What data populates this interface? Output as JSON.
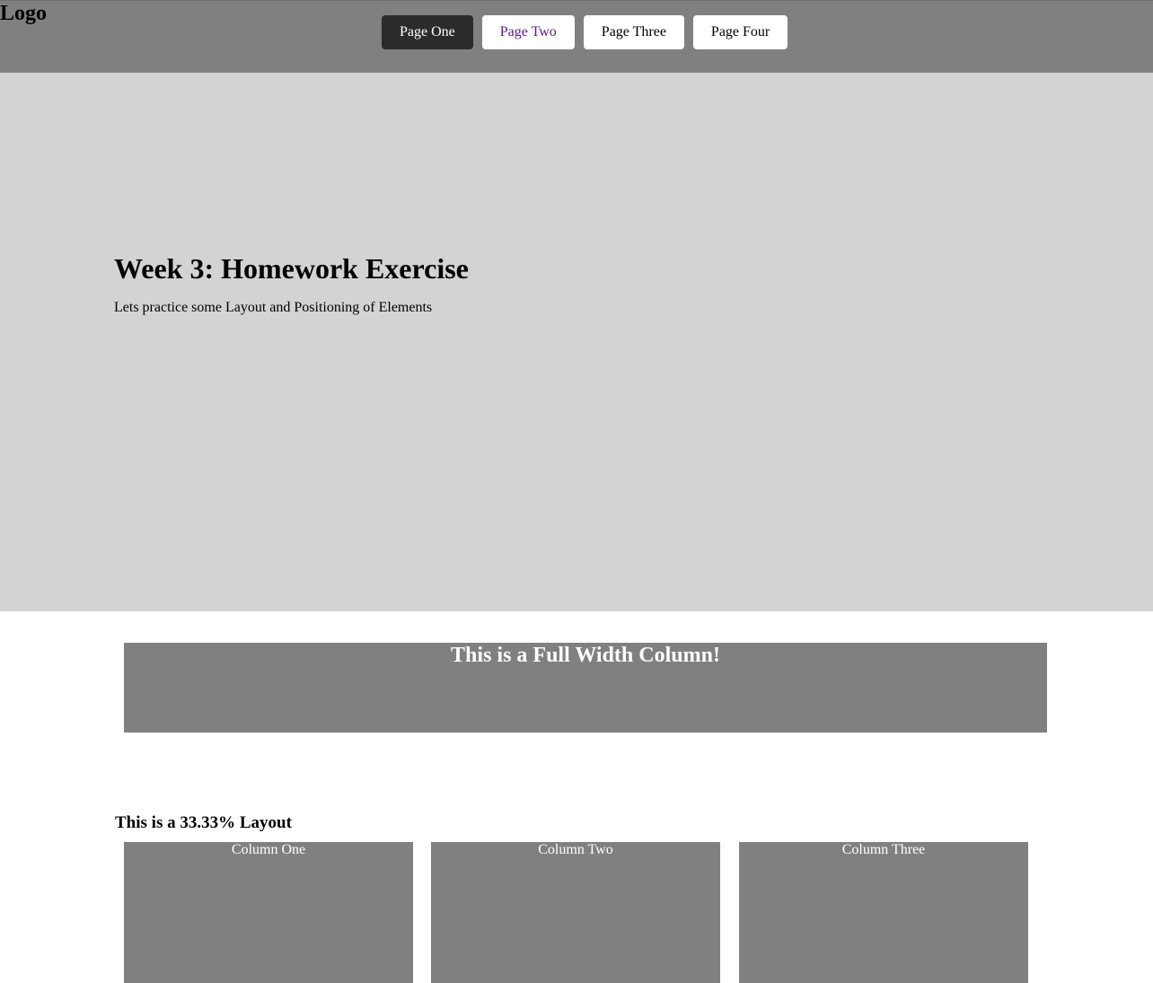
{
  "header": {
    "logo": "Logo",
    "nav": [
      {
        "label": "Page One"
      },
      {
        "label": "Page Two"
      },
      {
        "label": "Page Three"
      },
      {
        "label": "Page Four"
      }
    ]
  },
  "hero": {
    "title": "Week 3: Homework Exercise",
    "subtitle": "Lets practice some Layout and Positioning of Elements"
  },
  "full_width": {
    "heading": "This is a Full Width Column!"
  },
  "three_column": {
    "title": "This is a 33.33% Layout",
    "columns": [
      {
        "label": "Column One"
      },
      {
        "label": "Column Two"
      },
      {
        "label": "Column Three"
      }
    ]
  },
  "colors": {
    "header_bg": "#808080",
    "hero_bg": "#d3d3d3",
    "active_nav_bg": "#2b2b2b",
    "column_bg": "#808080",
    "visited_link": "#551a8b"
  }
}
